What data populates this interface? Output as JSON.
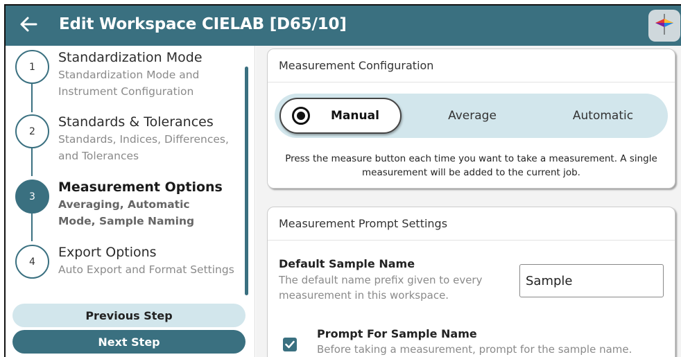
{
  "header": {
    "title": "Edit Workspace CIELAB [D65/10]",
    "back_icon": "arrow-left-icon",
    "app_icon": "color-swatch-logo-icon",
    "bg_color": "#3a7080"
  },
  "steps": [
    {
      "number": "1",
      "title": "Standardization Mode",
      "subtitle": "Standardization Mode and Instrument Configuration",
      "active": false
    },
    {
      "number": "2",
      "title": "Standards & Tolerances",
      "subtitle": "Standards, Indices, Differences, and Tolerances",
      "active": false
    },
    {
      "number": "3",
      "title": "Measurement Options",
      "subtitle": "Averaging, Automatic Mode, Sample Naming",
      "active": true
    },
    {
      "number": "4",
      "title": "Export Options",
      "subtitle": "Auto Export and Format Settings",
      "active": false
    }
  ],
  "nav": {
    "previous_label": "Previous Step",
    "next_label": "Next Step"
  },
  "measurement_config": {
    "header": "Measurement Configuration",
    "options": [
      "Manual",
      "Average",
      "Automatic"
    ],
    "selected": "Manual",
    "description": "Press the measure button each time you want to take a measurement. A single measurement will be added to the current job."
  },
  "prompt_settings": {
    "header": "Measurement Prompt Settings",
    "default_name_title": "Default Sample Name",
    "default_name_desc": "The default name prefix given to every measurement in this workspace.",
    "default_name_value": "Sample",
    "prompt_checkbox_title": "Prompt For Sample Name",
    "prompt_checkbox_desc": "Before taking a measurement, prompt for the sample name.",
    "prompt_checked": true
  }
}
